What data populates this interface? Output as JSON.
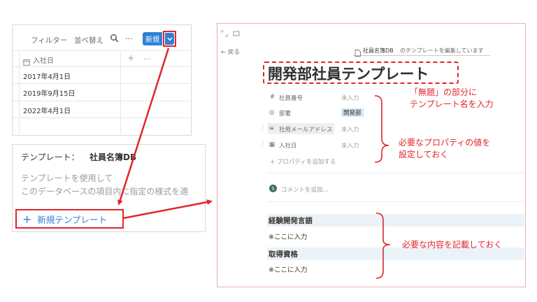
{
  "db_view": {
    "toolbar": {
      "filter": "フィルター",
      "sort": "並べ替え",
      "search_icon": "search-icon",
      "more": "…",
      "new_button": "新規",
      "dropdown_icon": "chevron-down-icon"
    },
    "column_header": "入社日",
    "add_column": "+",
    "column_more": "…",
    "rows": [
      "2017年4月1日",
      "2019年9月15日",
      "2022年4月1日"
    ]
  },
  "template_menu": {
    "heading_label": "テンプレート：",
    "heading_db": "社員名簿DB",
    "desc_line1": "テンプレートを使用して",
    "desc_line2": "このデータベースの項目内に指定の様式を適",
    "new_template": "新規テンプレート"
  },
  "editor": {
    "back": "← 戻る",
    "banner_db": "社員名簿DB",
    "banner_text": "のテンプレートを編集しています",
    "title": "開発部社員テンプレート",
    "properties": [
      {
        "icon": "#",
        "name": "社員番号",
        "value": "未入力"
      },
      {
        "icon": "◎",
        "name": "部署",
        "value": "開発部"
      },
      {
        "icon": "≡",
        "name": "社用メールアドレス",
        "value": "未入力"
      },
      {
        "icon": "▦",
        "name": "入社日",
        "value": "未入力"
      }
    ],
    "add_property": "+ プロパティを追加する",
    "comment_avatar": "S",
    "comment_placeholder": "コメントを追加…",
    "sections": [
      {
        "heading": "経験開発言語",
        "body": "※ここに入力"
      },
      {
        "heading": "取得資格",
        "body": "※ここに入力"
      }
    ]
  },
  "annotations": {
    "title_note_1": "「無題」の部分に",
    "title_note_2": "テンプレート名を入力",
    "props_note_1": "必要なプロパティの値を",
    "props_note_2": "設定しておく",
    "content_note": "必要な内容を記載しておく"
  },
  "colors": {
    "accent_red": "#e0262b",
    "button_blue": "#2f80d6",
    "tag_blue": "#d3e5ef",
    "section_band": "#ebf2f8"
  }
}
